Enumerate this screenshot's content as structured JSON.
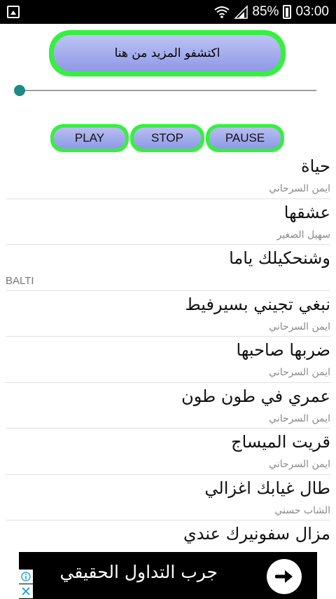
{
  "status_bar": {
    "battery": "85%",
    "time": "03:00",
    "icons": [
      "image-notification-icon",
      "wifi-icon",
      "signal-icon",
      "battery-charging-icon"
    ]
  },
  "discover_button": {
    "label": "اكتشفو المزيد من هنا"
  },
  "seekbar": {
    "progress": 0,
    "accent": "#1b8c84"
  },
  "controls": {
    "play": "PLAY",
    "stop": "STOP",
    "pause": "PAUSE"
  },
  "songs": [
    {
      "title": "حياة",
      "artist": "ايمن السرحاني"
    },
    {
      "title": "عشقها",
      "artist": "سهيل الصغير"
    },
    {
      "title": "وشنحكيلك ياما",
      "artist": "BALTI"
    },
    {
      "title": "نبغي تجيني بسيرفيط",
      "artist": "ايمن السرحاني"
    },
    {
      "title": "ضربها صاحبها",
      "artist": "ايمن السرحاني"
    },
    {
      "title": "عمري في طون طون",
      "artist": "ايمن السرحاني"
    },
    {
      "title": "قريت الميساج",
      "artist": "ايمن السرحاني"
    },
    {
      "title": "طال غيابك اغزالي",
      "artist": "الشاب حسني"
    },
    {
      "title": "مزال سفونيرك عندي",
      "artist": ""
    }
  ],
  "ad": {
    "text": "جرب التداول الحقيقي",
    "icons": [
      "arrow-right-icon",
      "ad-info-icon",
      "ad-close-icon"
    ]
  },
  "colors": {
    "button_border": "#35f03f",
    "button_fill": "#9aa3ea",
    "ad_background": "#000000"
  }
}
